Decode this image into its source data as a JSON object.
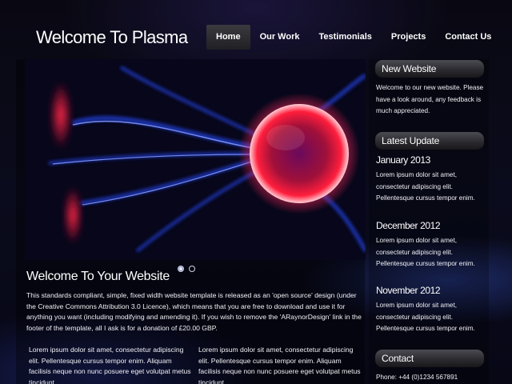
{
  "site": {
    "title": "Welcome To Plasma"
  },
  "nav": {
    "items": [
      "Home",
      "Our Work",
      "Testimonials",
      "Projects",
      "Contact Us"
    ],
    "active_index": 0
  },
  "slider": {
    "image": "plasma-ball-photo",
    "slide_count": 2,
    "active_slide": 1
  },
  "main": {
    "heading": "Welcome To Your Website",
    "intro": "This standards compliant, simple, fixed width website template is released as an 'open source' design (under the Creative Commons Attribution 3.0 Licence), which means that you are free to download and use it for anything you want (including modifying and amending it). If you wish to remove the 'ARaynorDesign' link in the footer of the template, all I ask is for a donation of £20.00 GBP.",
    "column_left": "Lorem ipsum dolor sit amet, consectetur adipiscing elit. Pellentesque cursus tempor enim. Aliquam facilisis neque non nunc posuere eget volutpat metus tincidunt.",
    "column_right": "Lorem ipsum dolor sit amet, consectetur adipiscing elit. Pellentesque cursus tempor enim. Aliquam facilisis neque non nunc posuere eget volutpat metus tincidunt."
  },
  "sidebar": {
    "new_website": {
      "title": "New Website",
      "text": "Welcome to our new website. Please have a look around, any feedback is much appreciated."
    },
    "latest_update": {
      "title": "Latest Update",
      "entries": [
        {
          "date": "January 2013",
          "text": "Lorem ipsum dolor sit amet, consectetur adipiscing elit. Pellentesque cursus tempor enim."
        },
        {
          "date": "December 2012",
          "text": "Lorem ipsum dolor sit amet, consectetur adipiscing elit. Pellentesque cursus tempor enim."
        },
        {
          "date": "November 2012",
          "text": "Lorem ipsum dolor sit amet, consectetur adipiscing elit. Pellentesque cursus tempor enim."
        }
      ]
    },
    "contact": {
      "title": "Contact",
      "phone": "Phone: +44 (0)1234 567891"
    }
  },
  "colors": {
    "background": "#090812",
    "nav_active": "#2e2e33",
    "heading_bar": "#333338",
    "plasma_red": "#ff1e3c",
    "plasma_blue": "#4a6bff"
  }
}
